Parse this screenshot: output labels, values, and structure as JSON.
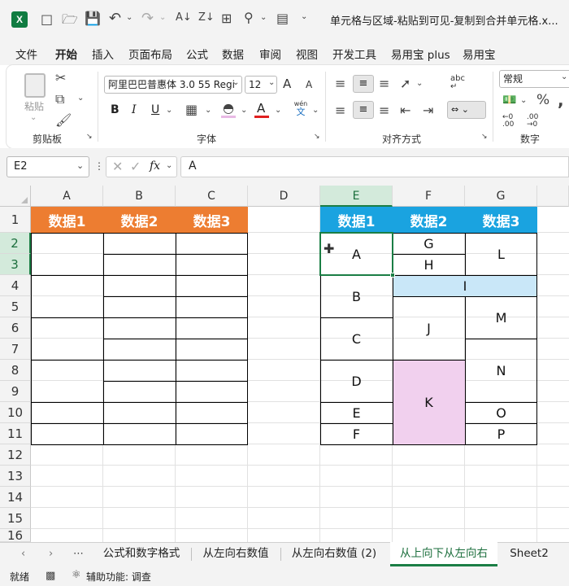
{
  "title": {
    "text": "单元格与区域-粘贴到可见-复制到合并单元格.x..."
  },
  "menu": [
    "文件",
    "开始",
    "插入",
    "页面布局",
    "公式",
    "数据",
    "审阅",
    "视图",
    "开发工具",
    "易用宝 plus",
    "易用宝"
  ],
  "ribbon": {
    "paste": "粘贴",
    "clipboard": "剪贴板",
    "font_name": "阿里巴巴普惠体 3.0 55 Regi",
    "font_size": "12",
    "bold": "B",
    "italic": "I",
    "underline": "U",
    "font_group": "字体",
    "align_group": "对齐方式",
    "number_format": "常规",
    "number_group": "数字",
    "wen": "wén",
    "wen2": "文",
    "abc": "ab",
    "abc2": "c",
    "grow": "A",
    "shrink": "A",
    "font_color": "A",
    "dec_inc": ".00",
    "dec_dec": ".00"
  },
  "formula_bar": {
    "name_box": "E2",
    "fx": "fx",
    "content": "A"
  },
  "columns": [
    "A",
    "B",
    "C",
    "D",
    "E",
    "F",
    "G"
  ],
  "rows": [
    "1",
    "2",
    "3",
    "4",
    "5",
    "6",
    "7",
    "8",
    "9",
    "10",
    "11",
    "12",
    "13",
    "14",
    "15",
    "16"
  ],
  "left_headers": [
    "数据1",
    "数据2",
    "数据3"
  ],
  "right_headers": [
    "数据1",
    "数据2",
    "数据3"
  ],
  "right_cells": {
    "A": "A",
    "B": "B",
    "C": "C",
    "D": "D",
    "E": "E",
    "F": "F",
    "G": "G",
    "H": "H",
    "I": "I",
    "J": "J",
    "K": "K",
    "L": "L",
    "M": "M",
    "N": "N",
    "O": "O",
    "P": "P"
  },
  "sheet_tabs": [
    "公式和数字格式",
    "从左向右数值",
    "从左向右数值 (2)",
    "从上向下从左向右",
    "Sheet2"
  ],
  "active_tab": "从上向下从左向右",
  "status": {
    "ready": "就绪",
    "accessibility": "辅助功能: 调查"
  },
  "colors": {
    "orange": "#ed7d31",
    "blue": "#1aa3e0",
    "light_blue": "#c9e7f8",
    "pink": "#f1d0ee",
    "accent": "#1b7e45"
  }
}
